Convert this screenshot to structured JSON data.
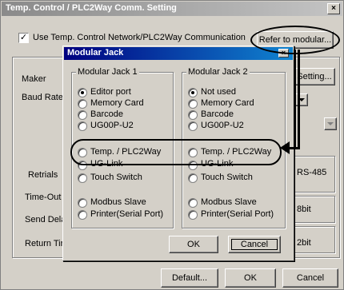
{
  "main_window": {
    "title": "Temp. Control / PLC2Way Comm. Setting",
    "close_glyph": "×",
    "use_network_checkbox": {
      "label": "Use Temp. Control Network/PLC2Way Communication",
      "checked_glyph": "✓"
    },
    "refer_button": "Refer to modular...",
    "setting_button": "Setting...",
    "labels": {
      "maker": "Maker",
      "baud_rate": "Baud Rate",
      "retrials": "Retrials",
      "time_out": "Time-Out T",
      "send_delay": "Send Dela",
      "return_time": "Return Tir"
    },
    "right_values": {
      "rs485": "RS-485",
      "data_bits": "8bit",
      "stop_bits": "2bit"
    },
    "buttons": {
      "default": "Default...",
      "ok": "OK",
      "cancel": "Cancel"
    }
  },
  "modular_jack_dialog": {
    "title": "Modular Jack",
    "close_glyph": "×",
    "jack1": {
      "title": "Modular Jack 1",
      "options": [
        "Editor port",
        "Memory Card",
        "Barcode",
        "UG00P-U2",
        "Temp. / PLC2Way",
        "UG-Link",
        "Touch Switch",
        "Modbus Slave",
        "Printer(Serial Port)"
      ],
      "selected": "Editor port"
    },
    "jack2": {
      "title": "Modular Jack 2",
      "options": [
        "Not used",
        "Memory Card",
        "Barcode",
        "UG00P-U2",
        "Temp. / PLC2Way",
        "UG-Link",
        "Touch Switch",
        "Modbus Slave",
        "Printer(Serial Port)"
      ],
      "selected": "Not used"
    },
    "ok_button": "OK",
    "cancel_button": "Cancel"
  },
  "icons": {
    "dropdown": "dropdown-arrow-icon"
  }
}
